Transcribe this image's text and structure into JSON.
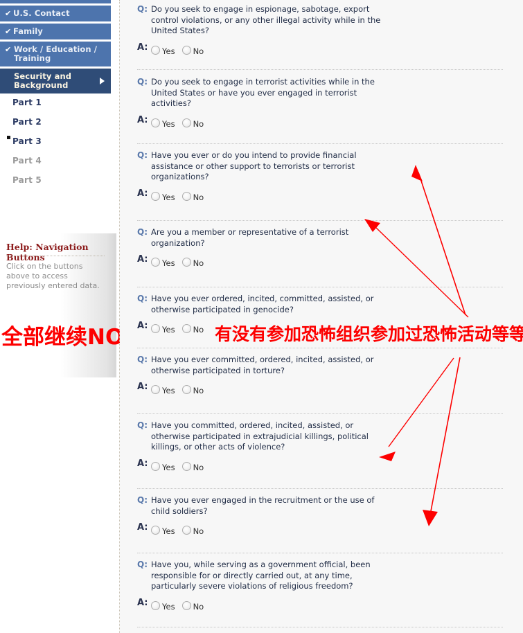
{
  "sidebar": {
    "nav_items": [
      {
        "label": "U.S. Contact",
        "checked": true,
        "state": "complete"
      },
      {
        "label": "Family",
        "checked": true,
        "state": "complete"
      },
      {
        "label": "Work / Education / Training",
        "checked": true,
        "state": "complete"
      },
      {
        "label": "Security and Background",
        "checked": false,
        "state": "current"
      }
    ],
    "check_glyph": "✔",
    "parts": [
      {
        "label": "Part 1",
        "state": "visited",
        "bullet": false
      },
      {
        "label": "Part 2",
        "state": "visited",
        "bullet": false
      },
      {
        "label": "Part 3",
        "state": "selected",
        "bullet": true
      },
      {
        "label": "Part 4",
        "state": "disabled",
        "bullet": false
      },
      {
        "label": "Part 5",
        "state": "disabled",
        "bullet": false
      }
    ]
  },
  "help": {
    "title": "Help: Navigation Buttons",
    "body": "Click on the buttons above to access previously entered data."
  },
  "annotations": {
    "left_note": "全部继续NO",
    "main_note": "有没有参加恐怖组织参加过恐怖活动等等",
    "ink_color": "#fd0000"
  },
  "form": {
    "q_prefix": "Q:",
    "a_prefix": "A:",
    "options": [
      "Yes",
      "No"
    ],
    "questions": [
      {
        "text": "Do you seek to engage in espionage, sabotage, export control violations, or any other illegal activity while in the United States?",
        "answer": null
      },
      {
        "text": "Do you seek to engage in terrorist activities while in the United States or have you ever engaged in terrorist activities?",
        "answer": null
      },
      {
        "text": "Have you ever or do you intend to provide financial assistance or other support to terrorists or terrorist organizations?",
        "answer": null
      },
      {
        "text": "Are you a member or representative of a terrorist organization?",
        "answer": null
      },
      {
        "text": "Have you ever ordered, incited, committed, assisted, or otherwise participated in genocide?",
        "answer": null
      },
      {
        "text": "Have you ever committed, ordered, incited, assisted, or otherwise participated in torture?",
        "answer": null
      },
      {
        "text": "Have you committed, ordered, incited, assisted, or otherwise participated in extrajudicial killings, political killings, or other acts of violence?",
        "answer": null
      },
      {
        "text": "Have you ever engaged in the recruitment or the use of child soldiers?",
        "answer": null
      },
      {
        "text": "Have you, while serving as a government official, been responsible for or directly carried out, at any time, particularly severe violations of religious freedom?",
        "answer": null
      }
    ]
  },
  "colors": {
    "nav_blue": "#4d74ad",
    "nav_current": "#2f4c77",
    "help_title": "#8c1b1b",
    "q_label": "#5a79ab",
    "a_label": "#2b3350",
    "content_bg": "#f7f7f7"
  }
}
